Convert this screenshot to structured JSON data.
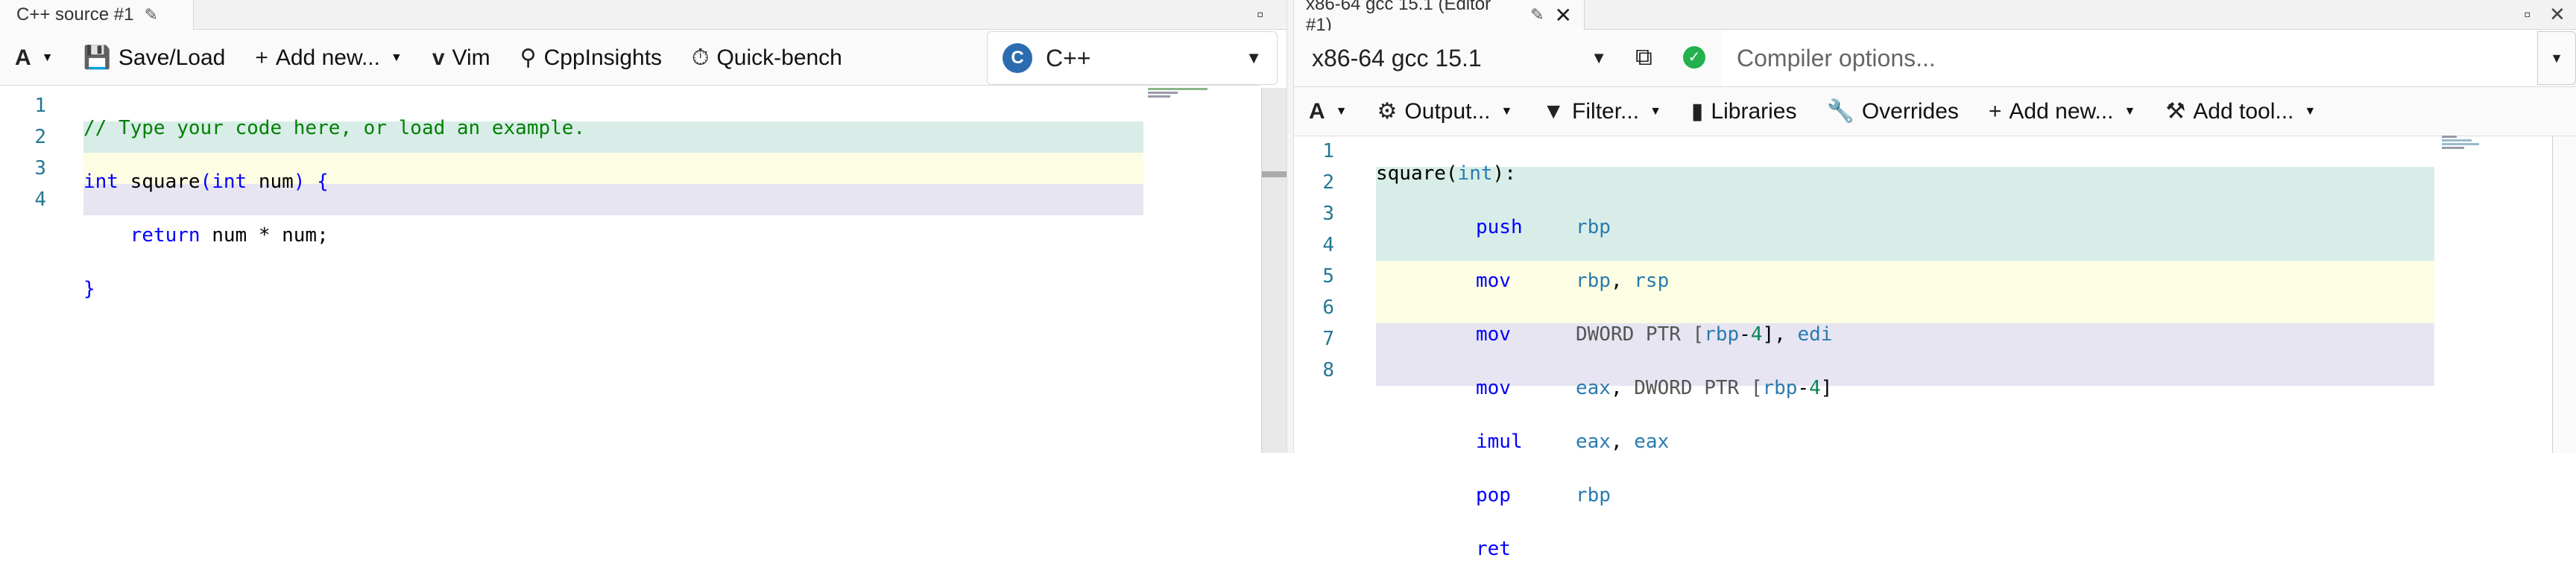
{
  "left": {
    "tab_title": "C++ source #1",
    "toolbar": {
      "save_load": "Save/Load",
      "add_new": "Add new...",
      "vim": "Vim",
      "cppinsights": "CppInsights",
      "quickbench": "Quick-bench"
    },
    "language": "C++",
    "lines": [
      {
        "n": "1"
      },
      {
        "n": "2"
      },
      {
        "n": "3"
      },
      {
        "n": "4"
      }
    ],
    "code": {
      "l1_comment": "// Type your code here, or load an example.",
      "l2_int": "int",
      "l2_name": "square",
      "l2_open": "(",
      "l2_int2": "int",
      "l2_param": "num",
      "l2_close": ") {",
      "l3_return": "return",
      "l3_expr": "num * num;",
      "l4_brace": "}"
    }
  },
  "right": {
    "tab_title": "x86-64 gcc 15.1 (Editor #1)",
    "compiler": "x86-64 gcc 15.1",
    "options_placeholder": "Compiler options...",
    "toolbar": {
      "output": "Output...",
      "filter": "Filter...",
      "libraries": "Libraries",
      "overrides": "Overrides",
      "add_new": "Add new...",
      "add_tool": "Add tool..."
    },
    "asm": [
      {
        "n": "1",
        "label": "square(",
        "label_arg": "int",
        "label_end": "):"
      },
      {
        "n": "2",
        "op": "push",
        "a1": "rbp"
      },
      {
        "n": "3",
        "op": "mov",
        "a1": "rbp",
        "sep": ", ",
        "a2": "rsp"
      },
      {
        "n": "4",
        "op": "mov",
        "ptr": "DWORD PTR [",
        "base": "rbp",
        "minus": "-",
        "off": "4",
        "close": "], ",
        "a2": "edi"
      },
      {
        "n": "5",
        "op": "mov",
        "a1": "eax",
        "sep": ", ",
        "ptr": "DWORD PTR [",
        "base": "rbp",
        "minus": "-",
        "off": "4",
        "close": "]"
      },
      {
        "n": "6",
        "op": "imul",
        "a1": "eax",
        "sep": ", ",
        "a2": "eax"
      },
      {
        "n": "7",
        "op": "pop",
        "a1": "rbp"
      },
      {
        "n": "8",
        "op": "ret"
      }
    ]
  },
  "colors": {
    "band_green": "#d8ede8",
    "band_yellow": "#fdfde3",
    "band_lavender": "#e6e5f1",
    "status_ok": "#22b14c"
  },
  "icons": [
    "pencil-icon",
    "close-icon",
    "maximize-icon",
    "font-icon",
    "save-icon",
    "plus-icon",
    "vim-icon",
    "cppinsights-icon",
    "quickbench-icon",
    "cpp-logo-icon",
    "chevron-down-icon",
    "external-link-icon",
    "status-ok-icon",
    "gear-icon",
    "filter-icon",
    "book-icon",
    "wrench-icon",
    "tool-icon"
  ]
}
